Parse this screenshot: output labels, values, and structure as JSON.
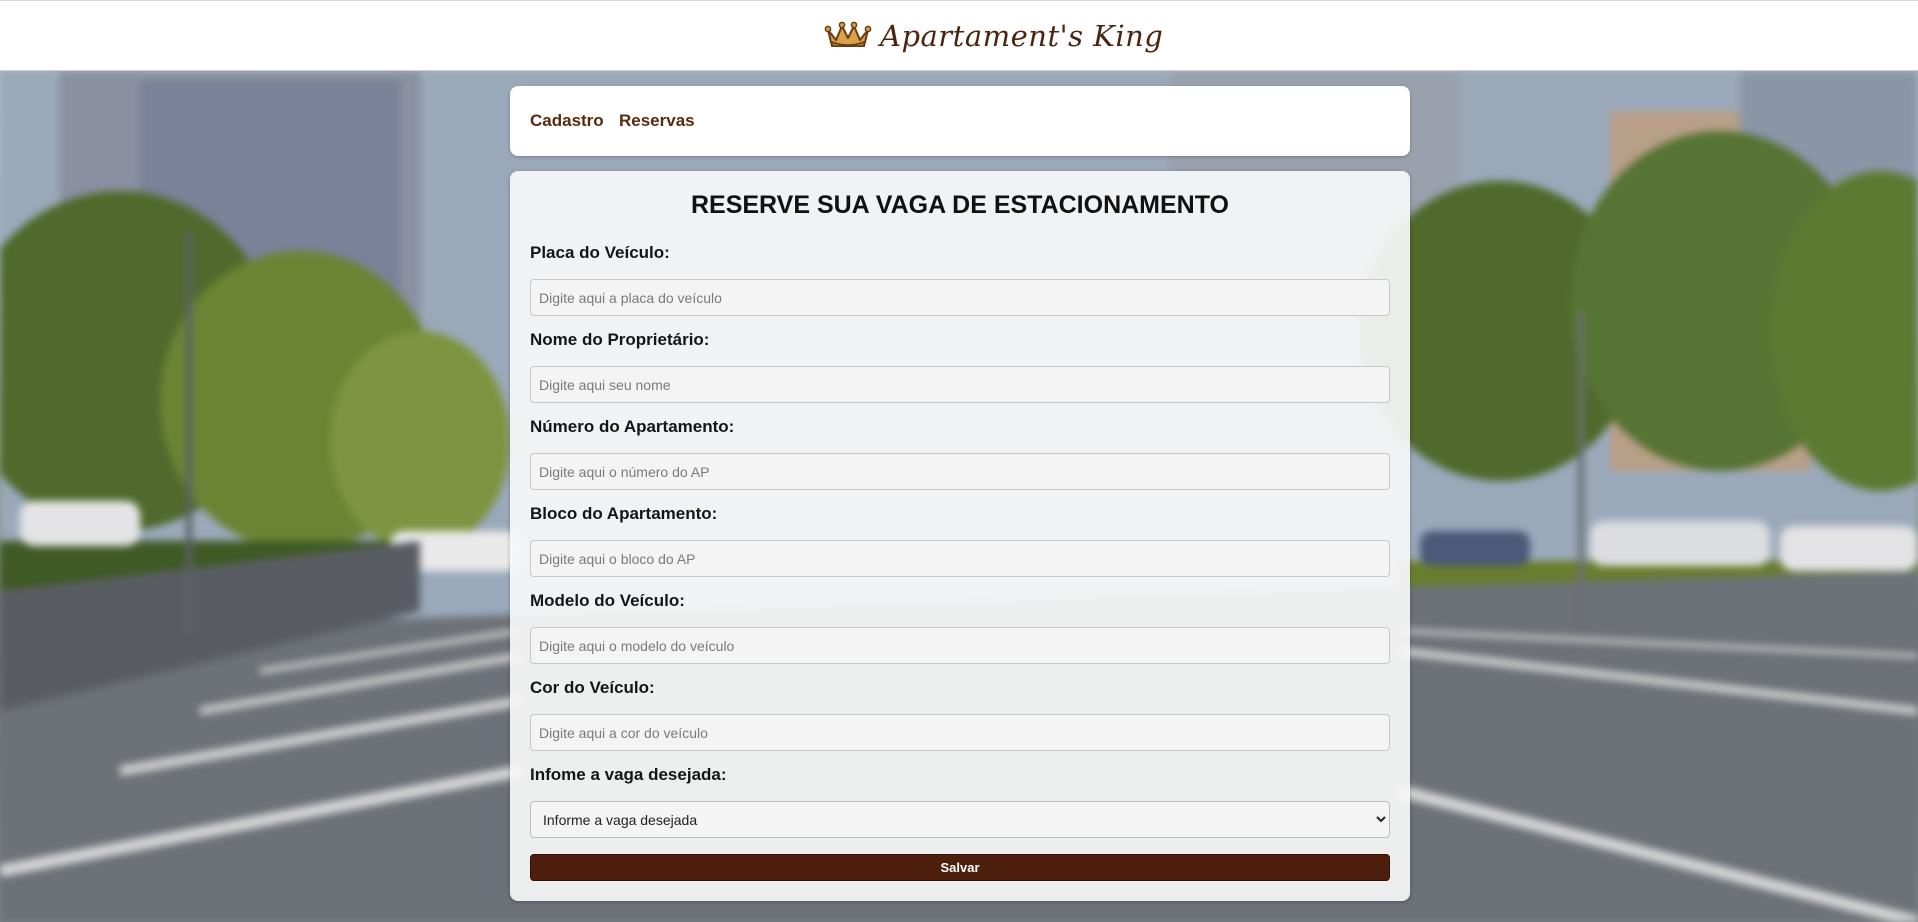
{
  "header": {
    "brand_name": "Apartament's King",
    "logo_icon": "crown-icon",
    "brand_color": "#4b2410"
  },
  "nav": {
    "items": [
      {
        "label": "Cadastro"
      },
      {
        "label": "Reservas"
      }
    ]
  },
  "form": {
    "title": "RESERVE SUA VAGA DE ESTACIONAMENTO",
    "fields": [
      {
        "label": "Placa do Veículo:",
        "placeholder": "Digite aqui a placa do veículo",
        "value": ""
      },
      {
        "label": "Nome do Proprietário:",
        "placeholder": "Digite aqui seu nome",
        "value": ""
      },
      {
        "label": "Número do Apartamento:",
        "placeholder": "Digite aqui o número do AP",
        "value": ""
      },
      {
        "label": "Bloco do Apartamento:",
        "placeholder": "Digite aqui o bloco do AP",
        "value": ""
      },
      {
        "label": "Modelo do Veículo:",
        "placeholder": "Digite aqui o modelo do veículo",
        "value": ""
      },
      {
        "label": "Cor do Veículo:",
        "placeholder": "Digite aqui a cor do veículo",
        "value": ""
      }
    ],
    "spot": {
      "label": "Infome a vaga desejada:",
      "selected": "Informe a vaga desejada"
    },
    "save_label": "Salvar",
    "button_color": "#4d1f0c"
  }
}
